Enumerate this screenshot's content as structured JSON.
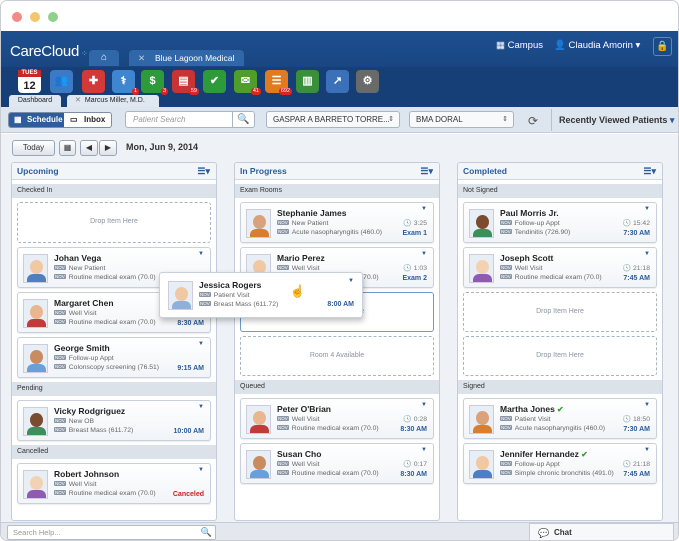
{
  "header": {
    "logo": "CareCloud",
    "home_icon": "⌂",
    "tab_close": "✕",
    "tab_label": "Blue Lagoon Medical",
    "campus": "Campus",
    "user": "Claudia Amorin",
    "lock_icon": "🔒"
  },
  "apps": [
    {
      "icon": "calendar-icon",
      "month": "TUES",
      "day": "12",
      "color": "#ffffff"
    },
    {
      "icon": "patients-icon",
      "glyph": "👥",
      "color": "#3c79c6"
    },
    {
      "icon": "chart-icon",
      "glyph": "✚",
      "color": "#d23a3a"
    },
    {
      "icon": "doctor-icon",
      "glyph": "⚕",
      "color": "#3f86d1",
      "badge": "1"
    },
    {
      "icon": "billing-icon",
      "glyph": "$",
      "color": "#2e9b3b",
      "badge": "3"
    },
    {
      "icon": "claims-icon",
      "glyph": "▤",
      "color": "#c83434",
      "badge": "59"
    },
    {
      "icon": "check-icon",
      "glyph": "✔",
      "color": "#2e9b3b"
    },
    {
      "icon": "mail-icon",
      "glyph": "✉",
      "color": "#4f9e2c",
      "badge": "41"
    },
    {
      "icon": "tasks-icon",
      "glyph": "☰",
      "color": "#e27a1f",
      "badge": "692"
    },
    {
      "icon": "library-icon",
      "glyph": "▥",
      "color": "#3a8f3a"
    },
    {
      "icon": "analytics-icon",
      "glyph": "↗",
      "color": "#3b71b8"
    },
    {
      "icon": "settings-icon",
      "glyph": "⚙",
      "color": "#6a6a6a"
    }
  ],
  "subtabs": {
    "dashboard": "Dashboard",
    "patient_close": "✕",
    "patient": "Marcus Miller, M.D."
  },
  "toolbar": {
    "schedule": "Schedule",
    "inbox": "Inbox",
    "search_placeholder": "Patient Search",
    "provider": "GASPAR A BARRETO TORRE...",
    "location": "BMA DORAL",
    "recent": "Recently Viewed Patients"
  },
  "nav": {
    "today": "Today",
    "prev": "◀",
    "next": "▶",
    "date": "Mon, Jun 9, 2014"
  },
  "columns": {
    "upcoming": {
      "title": "Upcoming",
      "sections": {
        "checked_in": "Checked In",
        "pending": "Pending",
        "cancelled": "Cancelled"
      },
      "drop": "Drop Item Here",
      "cards": [
        {
          "name": "Johan Vega",
          "l1": "New Patient",
          "l2": "Routine medical exam (70.0)",
          "time": "8:30 AM"
        },
        {
          "name": "Margaret Chen",
          "l1": "Well Visit",
          "l2": "Routine medical exam (70.0)",
          "time": "8:30 AM"
        },
        {
          "name": "George Smith",
          "l1": "Follow-up Appt",
          "l2": "Colonscopy screening (76.51)",
          "time": "9:15 AM"
        },
        {
          "name": "Vicky Rodgriguez",
          "l1": "New OB",
          "l2": "Breast Mass (611.72)",
          "time": "10:00 AM"
        },
        {
          "name": "Robert Johnson",
          "l1": "Well Visit",
          "l2": "Routine medical exam (70.0)",
          "time": "Canceled"
        }
      ]
    },
    "progress": {
      "title": "In Progress",
      "sections": {
        "exam": "Exam Rooms",
        "queued": "Queued"
      },
      "cards": [
        {
          "name": "Stephanie James",
          "l1": "New Patient",
          "l2": "Acute nasopharyngitis (460.0)",
          "elapsed": "3:25",
          "room": "Exam 1"
        },
        {
          "name": "Mario Perez",
          "l1": "Well Visit",
          "l2": "Routine medical exam (70.0)",
          "elapsed": "1:03",
          "room": "Exam 2"
        },
        {
          "name": "Peter O'Brian",
          "l1": "Well Visit",
          "l2": "Routine medical exam (70.0)",
          "elapsed": "0:28",
          "room": "8:30 AM"
        },
        {
          "name": "Susan Cho",
          "l1": "Well Visit",
          "l2": "Routine medical exam (70.0)",
          "elapsed": "0:17",
          "room": "8:30 AM"
        }
      ],
      "room3": "Room 3 Available",
      "room4": "Room 4 Available"
    },
    "completed": {
      "title": "Completed",
      "sections": {
        "not_signed": "Not Signed",
        "signed": "Signed"
      },
      "drop": "Drop Item Here",
      "cards": [
        {
          "name": "Paul Morris Jr.",
          "l1": "Follow-up Appt",
          "l2": "Tendinitis (726.90)",
          "elapsed": "15:42",
          "time": "7:30 AM"
        },
        {
          "name": "Joseph Scott",
          "l1": "Well Visit",
          "l2": "Routine medical exam (70.0)",
          "elapsed": "21:18",
          "time": "7:45 AM"
        },
        {
          "name": "Martha Jones",
          "l1": "Patient Visit",
          "l2": "Acute nasopharyngitis (460.0)",
          "elapsed": "18:50",
          "time": "7:30 AM"
        },
        {
          "name": "Jennifer Hernandez",
          "l1": "Follow-up Appt",
          "l2": "Simple chronic bronchitis (491.0)",
          "elapsed": "21:18",
          "time": "7:45 AM"
        }
      ]
    }
  },
  "dragged": {
    "name": "Jessica Rogers",
    "l1": "Patient Visit",
    "l2": "Breast Mass (611.72)",
    "time": "8:00 AM"
  },
  "tags": {
    "a": "NOV",
    "b": "NOV"
  },
  "glyphs": {
    "menu": "☰▾",
    "chevron": "▼",
    "clock": "🕓",
    "check": "✔",
    "cursor": "☝",
    "mag": "🔍",
    "refresh": "⟳",
    "grid": "▦"
  },
  "footer": {
    "search": "Search Help...",
    "chat": "Chat"
  }
}
